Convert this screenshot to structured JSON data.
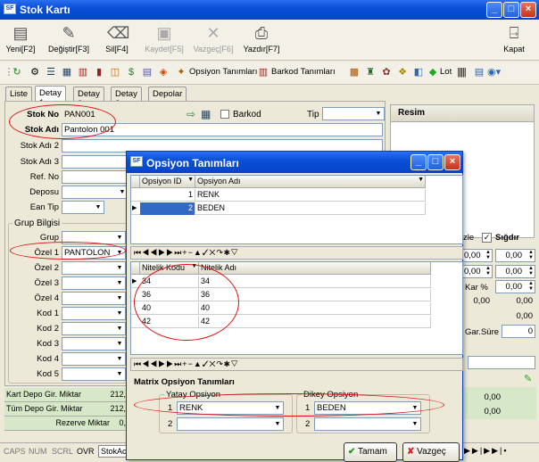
{
  "window": {
    "title": "Stok Kartı",
    "logo": "SF"
  },
  "toolbar": [
    {
      "icon": "new-doc-icon",
      "label": "Yeni[F2]",
      "enabled": true
    },
    {
      "icon": "edit-doc-icon",
      "label": "Değiştir[F3]",
      "enabled": true
    },
    {
      "icon": "eraser-icon",
      "label": "Sil[F4]",
      "enabled": true
    },
    {
      "icon": "save-icon",
      "label": "Kaydet[F5]",
      "enabled": false
    },
    {
      "icon": "cancel-x-icon",
      "label": "Vazgeç[F6]",
      "enabled": false
    },
    {
      "icon": "printer-icon",
      "label": "Yazdır[F7]",
      "enabled": true
    }
  ],
  "close_label": "Kapat",
  "iconbar": {
    "opsiyon_label": "Opsiyon Tanımları",
    "barkod_label": "Barkod Tanımları",
    "lot_label": "Lot"
  },
  "tabs": [
    "Liste",
    "Detay 1",
    "Detay 2",
    "Detay 3",
    "Depolar"
  ],
  "form": {
    "stok_no_label": "Stok No",
    "stok_no": "PAN001",
    "stok_adi_label": "Stok Adı",
    "stok_adi": "Pantolon 001",
    "stok_adi2_label": "Stok Adı 2",
    "stok_adi3_label": "Stok Adı 3",
    "ref_no_label": "Ref. No",
    "deposu_label": "Deposu",
    "ean_tip_label": "Ean Tip",
    "barkod_label": "Barkod",
    "tip_label": "Tip",
    "grup_bilgisi_label": "Grup Bilgisi",
    "grup_label": "Grup",
    "ozel_labels": [
      "Özel 1",
      "Özel 2",
      "Özel 3",
      "Özel 4"
    ],
    "ozel1_value": "PANTOLON",
    "kod_labels": [
      "Kod 1",
      "Kod 2",
      "Kod 3",
      "Kod 4",
      "Kod 5"
    ]
  },
  "resim_label": "Resim",
  "right_panel": {
    "izle_label": "zle",
    "sigdir_label": "Sığdır",
    "spin_values": [
      "0,00",
      "0,00",
      "0,00",
      "0,00"
    ],
    "kar_label": "Kar %",
    "kar_value": "0,00",
    "values": [
      "0,00",
      "0,00",
      "0,00"
    ],
    "gar_label": "Gar.Süre",
    "gar_value": "0",
    "bottom_values": [
      "0,00",
      "0,00"
    ]
  },
  "bottom_grid": [
    {
      "label": "Kart Depo Gir. Miktar",
      "value": "212,"
    },
    {
      "label": "Tüm Depo Gir. Miktar",
      "value": "212,"
    },
    {
      "label": "Rezerve Miktar",
      "value": "0,"
    }
  ],
  "statusbar": [
    "CAPS",
    "NUM",
    "SCRL",
    "OVR",
    "StokAc"
  ],
  "dialog": {
    "title": "Opsiyon Tanımları",
    "grid1": {
      "headers": [
        "Opsiyon ID",
        "Opsiyon Adı"
      ],
      "rows": [
        [
          "1",
          "RENK"
        ],
        [
          "2",
          "BEDEN"
        ]
      ]
    },
    "grid2": {
      "headers": [
        "Nitelik Kodu",
        "Nitelik Adı"
      ],
      "rows": [
        [
          "34",
          "34"
        ],
        [
          "36",
          "36"
        ],
        [
          "40",
          "40"
        ],
        [
          "42",
          "42"
        ]
      ]
    },
    "matrix_label": "Matrix Opsiyon Tanımları",
    "yatay_label": "Yatay Opsiyon",
    "dikey_label": "Dikey Opsiyon",
    "yatay_rows": [
      {
        "num": "1",
        "value": "RENK"
      },
      {
        "num": "2",
        "value": ""
      }
    ],
    "dikey_rows": [
      {
        "num": "1",
        "value": "BEDEN"
      },
      {
        "num": "2",
        "value": ""
      }
    ],
    "ok_label": "Tamam",
    "cancel_label": "Vazgeç"
  },
  "colors": {
    "title_blue": "#0a4fd6",
    "highlight": "#316ac5",
    "annotation_red": "#dd1111"
  }
}
